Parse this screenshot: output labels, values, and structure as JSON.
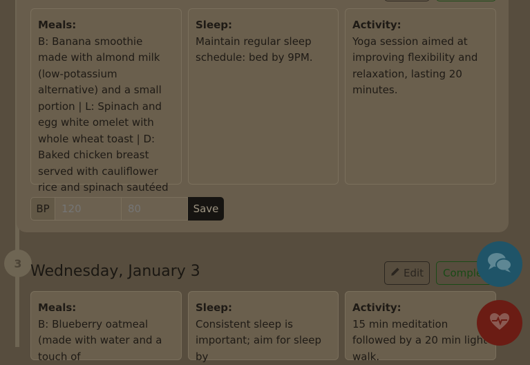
{
  "day_one": {
    "meals": {
      "label": "Meals:",
      "text": "B: Banana smoothie made with almond milk (low-potassium alternative) and a small portion | L: Spinach and egg white omelet with whole wheat toast | D: Baked chicken breast served with cauliflower rice and spinach sautéed in olive oil"
    },
    "sleep": {
      "label": "Sleep:",
      "text": "Maintain regular sleep schedule: bed by 9PM."
    },
    "activity": {
      "label": "Activity:",
      "text": "Yoga session aimed at improving flexibility and relaxation, lasting 20 minutes."
    },
    "bp": {
      "label": "BP",
      "systolic_placeholder": "120",
      "diastolic_placeholder": "80",
      "save_label": "Save"
    }
  },
  "day_two": {
    "step_number": "3",
    "title": "Wednesday, January 3",
    "edit_label": "Edit",
    "complete_label": "Complete",
    "meals": {
      "label": "Meals:",
      "text": "B: Blueberry oatmeal (made with water and a touch of"
    },
    "sleep": {
      "label": "Sleep:",
      "text": "Consistent sleep is important; aim for sleep by"
    },
    "activity": {
      "label": "Activity:",
      "text": "15 min meditation followed by a 20 min light walk."
    }
  },
  "colors": {
    "chat_fab": "#1f5468",
    "health_fab": "#6b1c14",
    "overlay_bg": "#574d3e"
  },
  "icons": {
    "chat": "chat-bubbles-icon",
    "heart": "heart-pulse-icon",
    "edit": "pencil-icon"
  }
}
